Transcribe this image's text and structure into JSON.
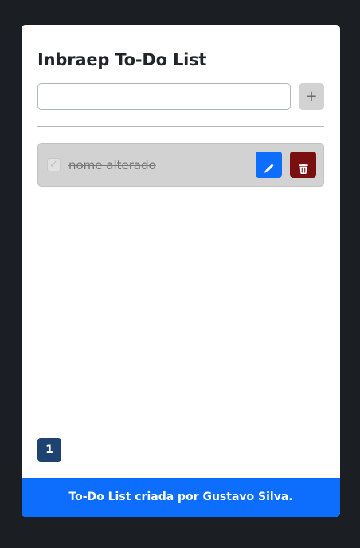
{
  "app": {
    "title": "Inbraep To-Do List"
  },
  "input": {
    "value": "",
    "placeholder": ""
  },
  "add_button": {
    "label": "+"
  },
  "tasks": [
    {
      "name": "nome alterado",
      "completed": true,
      "check_glyph": "✓",
      "edit_icon": "pencil-icon",
      "delete_icon": "trash-icon"
    }
  ],
  "pagination": {
    "current_page": "1"
  },
  "footer": {
    "text": "To-Do List criada por Gustavo Silva."
  },
  "colors": {
    "background": "#1b1f23",
    "card": "#ffffff",
    "primary": "#0d6efd",
    "danger": "#7a0f0f",
    "task_done_bg": "#d2d2d2",
    "page_active": "#1f4371"
  }
}
